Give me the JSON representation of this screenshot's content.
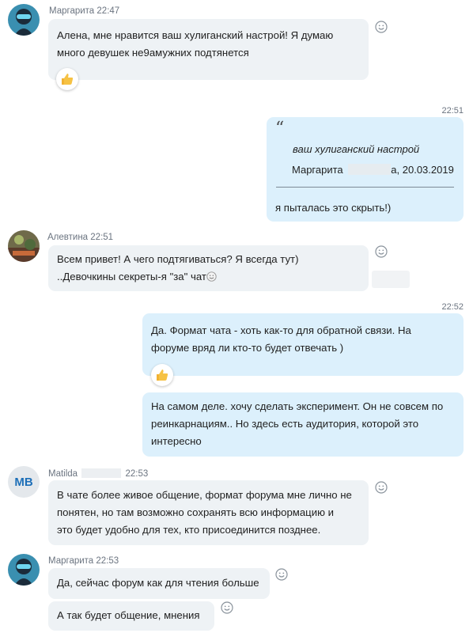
{
  "messages": [
    {
      "sender": "Маргарита",
      "time": "22:47",
      "lines": [
        "Алена, мне нравится ваш хулиганский настрой! Я думаю",
        "много девушек не9амужних подтянется"
      ],
      "reaction_icon": "thumbs-up-icon"
    },
    {
      "time": "22:51",
      "quote": {
        "text": "ваш хулиганский настрой",
        "author_visible": "Маргарита",
        "author_redacted_tail": "а",
        "date": "20.03.2019"
      },
      "reply": "я пыталась это скрыть!)"
    },
    {
      "sender": "Алевтина",
      "time": "22:51",
      "lines": [
        "Всем привет! А чего подтягиваться?  Я всегда тут)",
        "..Девочкины секреты-я \"за\" чат"
      ]
    },
    {
      "time": "22:52",
      "lines": [
        "Да. Формат чата - хоть как-то для обратной связи. На",
        "форуме вряд ли кто-то будет отвечать )"
      ],
      "reaction_icon": "thumbs-up-icon"
    },
    {
      "lines": [
        "На самом деле. хочу сделать эксперимент. Он не совсем по",
        "реинкарнациям.. Но здесь есть аудитория, которой это",
        "интересно"
      ]
    },
    {
      "sender": "Matilda",
      "time": "22:53",
      "avatar_initials": "MB",
      "lines": [
        "В чате более живое общение, формат форума мне лично не",
        "понятен, но там возможно сохранять всю информацию и",
        "это будет удобно для тех, кто присоединится позднее."
      ]
    },
    {
      "sender": "Маргарита",
      "time": "22:53",
      "lines": [
        "Да, сейчас форум как для чтения больше"
      ]
    },
    {
      "lines": [
        "А так будет общение, мнения"
      ]
    }
  ],
  "colors": {
    "incoming_bubble": "#eef2f5",
    "outgoing_bubble": "#dcf0fc",
    "meta_text": "#6b7480",
    "initials_avatar_bg": "#e4e8ec",
    "initials_text": "#1d6fb8"
  },
  "icons": [
    "smiley-react-icon",
    "thumbs-up-icon",
    "quote-icon",
    "smile-emoji-icon"
  ]
}
